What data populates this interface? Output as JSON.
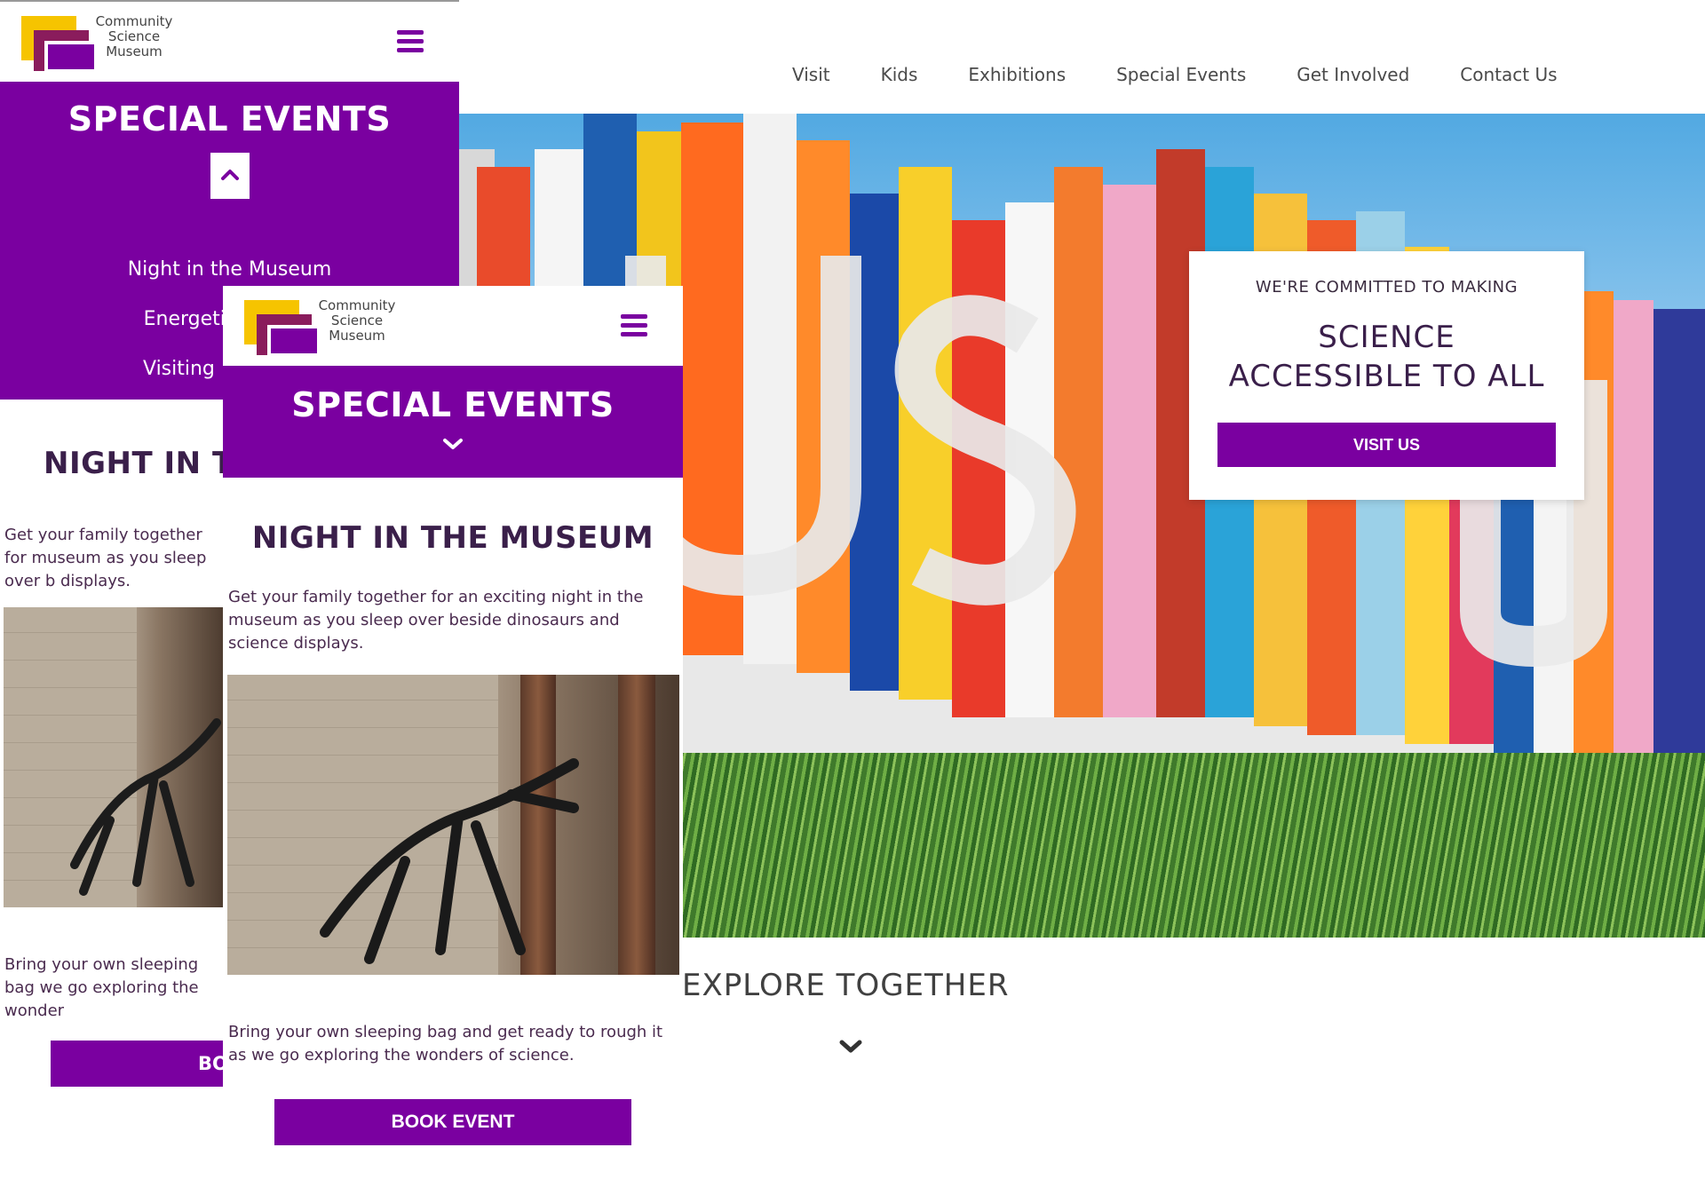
{
  "brand": {
    "logo_lines": [
      "Community",
      "Science",
      "Museum"
    ],
    "accent": "#7a00a0",
    "logo_yellow": "#f6c400",
    "logo_maroon": "#8a1c5c"
  },
  "desktop": {
    "nav": [
      "Visit",
      "Kids",
      "Exhibitions",
      "Special Events",
      "Get Involved",
      "Contact Us"
    ],
    "hero": {
      "kicker": "WE'RE COMMITTED TO MAKING",
      "headline_line1": "SCIENCE",
      "headline_line2": "ACCESSIBLE TO ALL",
      "button": "VISIT US"
    },
    "explore": "EXPLORE TOGETHER",
    "icons": {
      "explore": "chevron-down-icon"
    }
  },
  "mobile_open": {
    "section_title": "SPECIAL EVENTS",
    "menu_links": [
      "Night in the Museum",
      "Energetica Exh",
      "Visiting Profess"
    ],
    "heading": "NIGHT IN TH",
    "para1": "Get your family together for museum as you sleep over b displays.",
    "para2": "Bring your own sleeping bag we go exploring the wonder",
    "button": "BOOK",
    "icons": {
      "menu": "hamburger-icon",
      "collapse": "chevron-up-icon"
    }
  },
  "mobile_closed": {
    "section_title": "SPECIAL EVENTS",
    "heading": "NIGHT IN THE MUSEUM",
    "para1": "Get your family together for an exciting night in the museum as you sleep over beside dinosaurs and science displays.",
    "para2": "Bring your own sleeping bag and get ready to rough it as we go exploring the wonders of science.",
    "button": "BOOK EVENT",
    "icons": {
      "menu": "hamburger-icon",
      "expand": "chevron-down-icon"
    }
  }
}
